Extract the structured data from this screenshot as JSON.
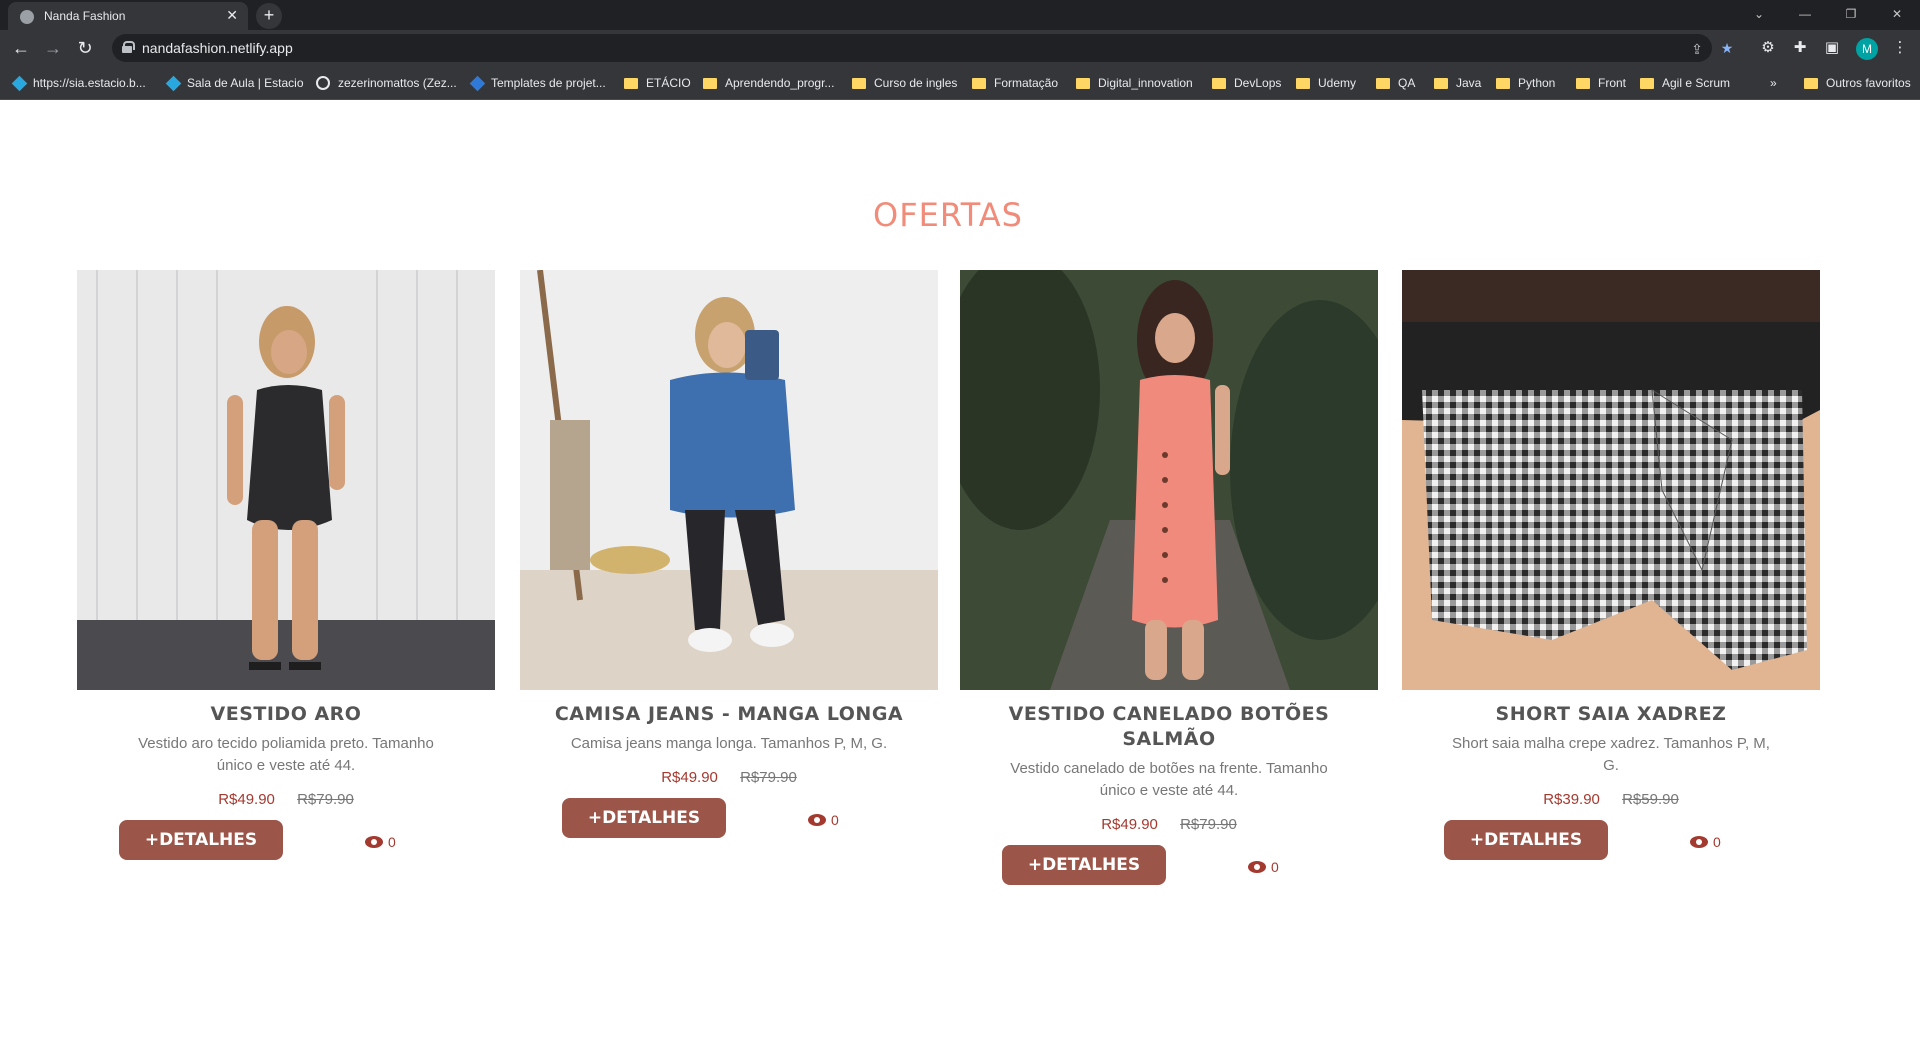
{
  "browser": {
    "tab_title": "Nanda Fashion",
    "tab_close": "✕",
    "new_tab": "+",
    "url": "nandafashion.netlify.app",
    "window_controls": [
      "⌄",
      "—",
      "❐",
      "✕"
    ],
    "bookmarks": [
      {
        "label": "https://sia.estacio.b...",
        "icon": "diamond-icon"
      },
      {
        "label": "Sala de Aula | Estacio",
        "icon": "diamond-icon"
      },
      {
        "label": "zezerinomattos (Zez...",
        "icon": "github-icon"
      },
      {
        "label": "Templates de projet...",
        "icon": "jira-icon"
      },
      {
        "label": "ETÁCIO",
        "icon": "folder-icon"
      },
      {
        "label": "Aprendendo_progr...",
        "icon": "folder-icon"
      },
      {
        "label": "Curso de ingles",
        "icon": "folder-icon"
      },
      {
        "label": "Formatação",
        "icon": "folder-icon"
      },
      {
        "label": "Digital_innovation",
        "icon": "folder-icon"
      },
      {
        "label": "DevLops",
        "icon": "folder-icon"
      },
      {
        "label": "Udemy",
        "icon": "folder-icon"
      },
      {
        "label": "QA",
        "icon": "folder-icon"
      },
      {
        "label": "Java",
        "icon": "folder-icon"
      },
      {
        "label": "Python",
        "icon": "folder-icon"
      },
      {
        "label": "Front",
        "icon": "folder-icon"
      },
      {
        "label": "Agil e Scrum",
        "icon": "folder-icon"
      }
    ],
    "more_bookmarks": "»",
    "other_favorites": "Outros favoritos",
    "profile_initial": "M"
  },
  "section": {
    "title": "OFERTAS"
  },
  "products": [
    {
      "name": "VESTIDO ARO",
      "description": "Vestido aro tecido poliamida preto. Tamanho único e veste até 44.",
      "price": "R$49.90",
      "old_price": "R$79.90",
      "button": "+DETALHES",
      "views": "0"
    },
    {
      "name": "CAMISA JEANS - MANGA LONGA",
      "description": "Camisa jeans manga longa. Tamanhos P, M, G.",
      "price": "R$49.90",
      "old_price": "R$79.90",
      "button": "+DETALHES",
      "views": "0"
    },
    {
      "name": "VESTIDO CANELADO BOTÕES SALMÃO",
      "description": "Vestido canelado de botões na frente. Tamanho único e veste até 44.",
      "price": "R$49.90",
      "old_price": "R$79.90",
      "button": "+DETALHES",
      "views": "0"
    },
    {
      "name": "SHORT SAIA XADREZ",
      "description": "Short saia malha crepe xadrez. Tamanhos P, M, G.",
      "price": "R$39.90",
      "old_price": "R$59.90",
      "button": "+DETALHES",
      "views": "0"
    }
  ],
  "colors": {
    "title": "#f28c7a",
    "button": "#9c5549",
    "price": "#a33a30"
  }
}
